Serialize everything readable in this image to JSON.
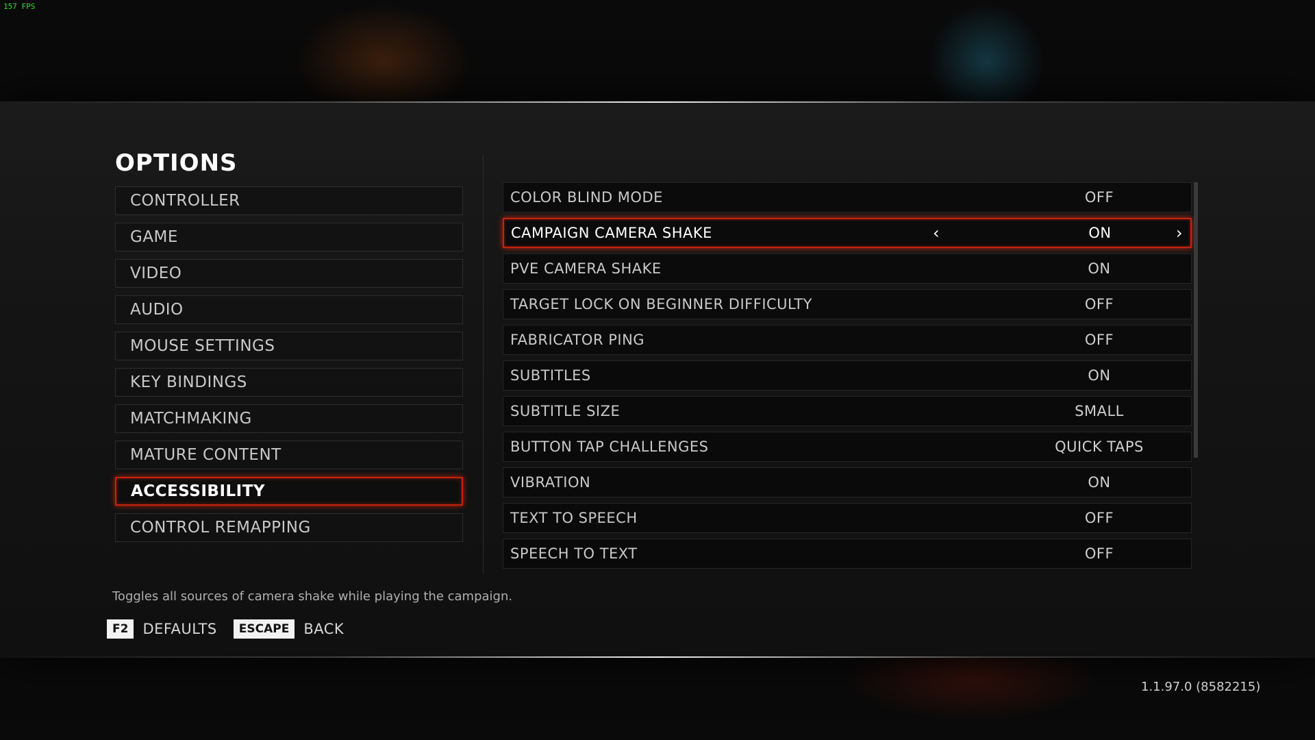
{
  "hud": {
    "fps": "157 FPS"
  },
  "options": {
    "title": "OPTIONS",
    "menu": [
      {
        "label": "CONTROLLER"
      },
      {
        "label": "GAME"
      },
      {
        "label": "VIDEO"
      },
      {
        "label": "AUDIO"
      },
      {
        "label": "MOUSE SETTINGS"
      },
      {
        "label": "KEY BINDINGS"
      },
      {
        "label": "MATCHMAKING"
      },
      {
        "label": "MATURE CONTENT"
      },
      {
        "label": "ACCESSIBILITY",
        "active": true
      },
      {
        "label": "CONTROL REMAPPING"
      }
    ],
    "settings": [
      {
        "label": "COLOR BLIND MODE",
        "value": "OFF"
      },
      {
        "label": "CAMPAIGN CAMERA SHAKE",
        "value": "ON",
        "selected": true
      },
      {
        "label": "PVE CAMERA SHAKE",
        "value": "ON"
      },
      {
        "label": "TARGET LOCK ON BEGINNER DIFFICULTY",
        "value": "OFF"
      },
      {
        "label": "FABRICATOR PING",
        "value": "OFF"
      },
      {
        "label": "SUBTITLES",
        "value": "ON"
      },
      {
        "label": "SUBTITLE SIZE",
        "value": "SMALL"
      },
      {
        "label": "BUTTON TAP CHALLENGES",
        "value": "QUICK TAPS"
      },
      {
        "label": "VIBRATION",
        "value": "ON"
      },
      {
        "label": "TEXT TO SPEECH",
        "value": "OFF"
      },
      {
        "label": "SPEECH TO TEXT",
        "value": "OFF"
      }
    ],
    "arrows": {
      "left": "‹",
      "right": "›"
    },
    "description": "Toggles all sources of camera shake while playing the campaign."
  },
  "footer": {
    "defaults_key": "F2",
    "defaults_label": "DEFAULTS",
    "back_key": "ESCAPE",
    "back_label": "BACK"
  },
  "version": "1.1.97.0 (8582215)",
  "colors": {
    "accent": "#c8220e",
    "fps": "#2fe02f"
  }
}
